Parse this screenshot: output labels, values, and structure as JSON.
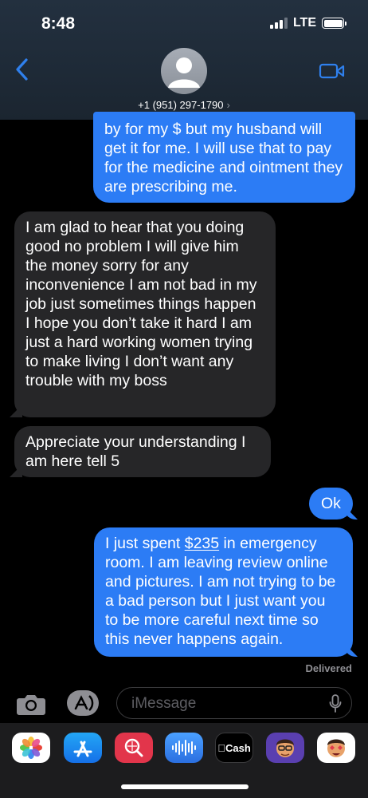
{
  "status_bar": {
    "time": "8:48",
    "network": "LTE"
  },
  "header": {
    "contact": "+1 (951) 297-1790",
    "chevron": "›"
  },
  "messages": [
    {
      "from": "me",
      "text": "by for my $ but my husband will get it for me. I will use that to pay for the medicine and ointment they are prescribing me."
    },
    {
      "from": "them",
      "text": "I am glad to hear that you doing good no problem I will give him the money sorry for any inconvenience I am not bad in my job just sometimes things happen I hope you don’t take it hard I am just a hard working women trying to make living I don’t want any trouble with my boss"
    },
    {
      "from": "them",
      "text": "Appreciate your understanding I am here tell 5"
    },
    {
      "from": "me",
      "text": "Ok"
    },
    {
      "from": "me",
      "text_before": "I just spent ",
      "amount": "$235",
      "text_after": " in emergency room. I am leaving review online and pictures. I am not trying to be a bad person but I just want you to be more careful next time so this never happens again."
    }
  ],
  "delivered": "Delivered",
  "composer": {
    "placeholder": "iMessage"
  },
  "app_drawer": {
    "apps": [
      {
        "icon": "photos-icon"
      },
      {
        "icon": "app-store-icon"
      },
      {
        "icon": "image-search-icon"
      },
      {
        "icon": "audio-message-icon"
      },
      {
        "icon": "apple-cash-icon",
        "label": "Cash"
      },
      {
        "icon": "memoji-icon"
      },
      {
        "icon": "memoji-stickers-icon"
      }
    ]
  },
  "colors": {
    "sent_bubble": "#2c7cf5",
    "received_bubble": "#262628",
    "accent": "#2f80ed"
  }
}
